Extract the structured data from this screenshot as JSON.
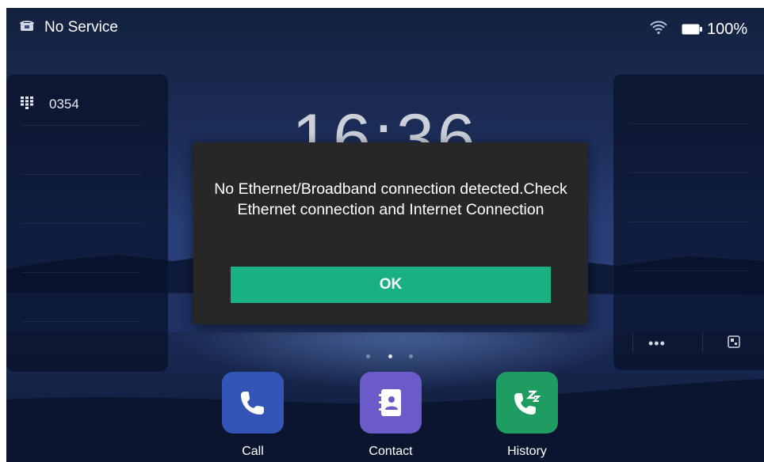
{
  "status_bar": {
    "service": "No Service",
    "battery": "100%",
    "icons": [
      "phone-icon",
      "wifi-icon",
      "battery-icon"
    ]
  },
  "left_panel": {
    "line_label": "0354",
    "icon": "dialpad-icon"
  },
  "right_panel": {
    "more_label": "•••",
    "icons": [
      "more-icon",
      "expand-icon"
    ]
  },
  "clock": {
    "time": "16:36"
  },
  "dialog": {
    "message": "No Ethernet/Broadband connection detected.Check Ethernet connection and Internet Connection",
    "ok_label": "OK"
  },
  "page_dots": {
    "count": 3,
    "active_index": 1
  },
  "dock": {
    "apps": [
      {
        "label": "Call",
        "icon": "phone-icon",
        "color": "#3355b8"
      },
      {
        "label": "Contact",
        "icon": "contact-book-icon",
        "color": "#6a5bc8"
      },
      {
        "label": "History",
        "icon": "call-history-icon",
        "color": "#1e9c62"
      }
    ]
  },
  "colors": {
    "accent": "#19b084",
    "dialog_bg": "#272728"
  }
}
